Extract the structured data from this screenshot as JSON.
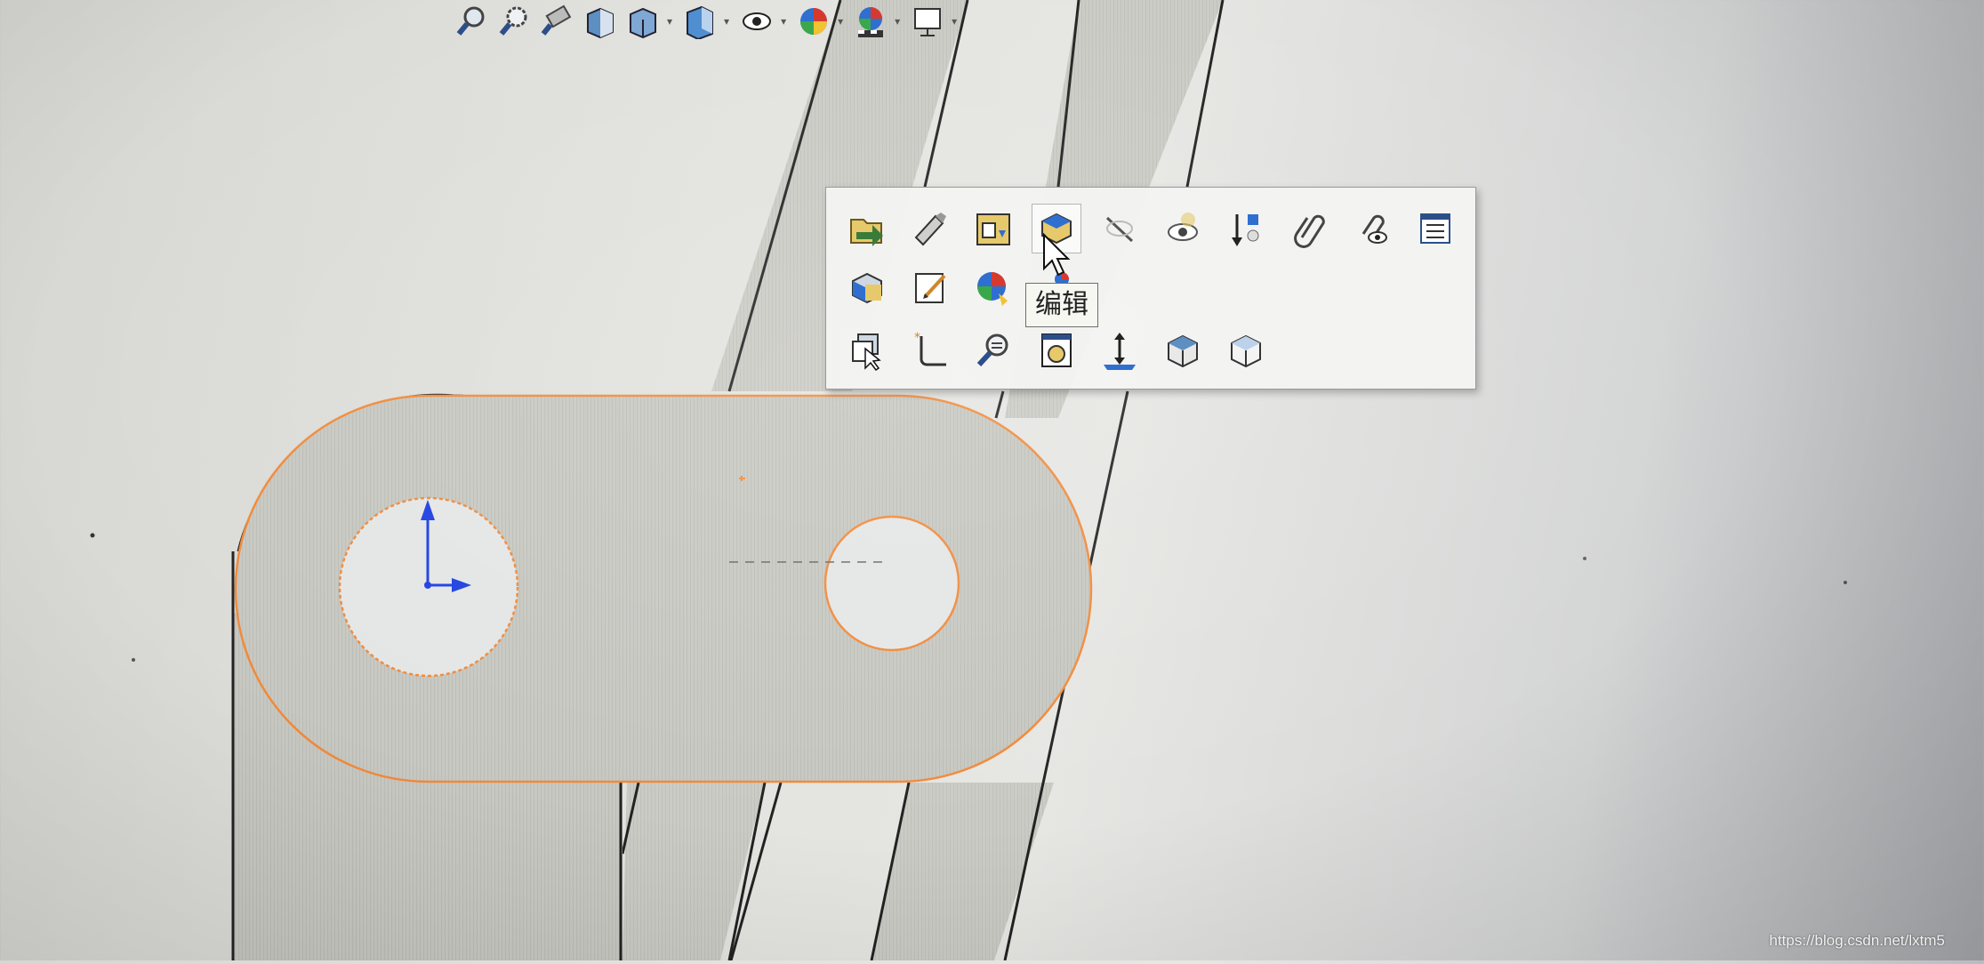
{
  "hud_toolbar": {
    "buttons": [
      {
        "icon": "zoom-to-fit-icon"
      },
      {
        "icon": "zoom-to-area-icon"
      },
      {
        "icon": "previous-view-icon"
      },
      {
        "icon": "section-view-icon"
      },
      {
        "icon": "view-orientation-icon"
      },
      {
        "icon": "display-style-icon"
      },
      {
        "icon": "hide-show-items-icon"
      },
      {
        "icon": "edit-appearance-icon"
      },
      {
        "icon": "apply-scene-icon"
      },
      {
        "icon": "view-settings-icon"
      }
    ]
  },
  "context_menu": {
    "row1": [
      "open-part-icon",
      "rebuild-icon",
      "configure-feature-icon",
      "edit-feature-icon",
      "hide-line-icon",
      "hide-component-icon",
      "move-rollback-icon",
      "attach-icon",
      "isolate-icon",
      "properties-list-icon"
    ],
    "row2": [
      "edit-part-icon",
      "edit-sketch-icon",
      "appearance-icon",
      "color-sphere-icon"
    ],
    "row3": [
      "select-other-icon",
      "sketch-corner-icon",
      "zoom-to-selection-icon",
      "normal-to-icon",
      "measure-icon",
      "view-cube-icon",
      "view-cube-shaded-icon"
    ],
    "hovered_index": 3
  },
  "tooltip": {
    "text": "编辑"
  },
  "watermark": {
    "text": "https://blog.csdn.net/lxtm5"
  },
  "colors": {
    "sketch_orange": "#f08a3a",
    "part_face": "#c9c9c3",
    "part_edge": "#2a2a2a",
    "axis_blue": "#1c3fe0"
  }
}
